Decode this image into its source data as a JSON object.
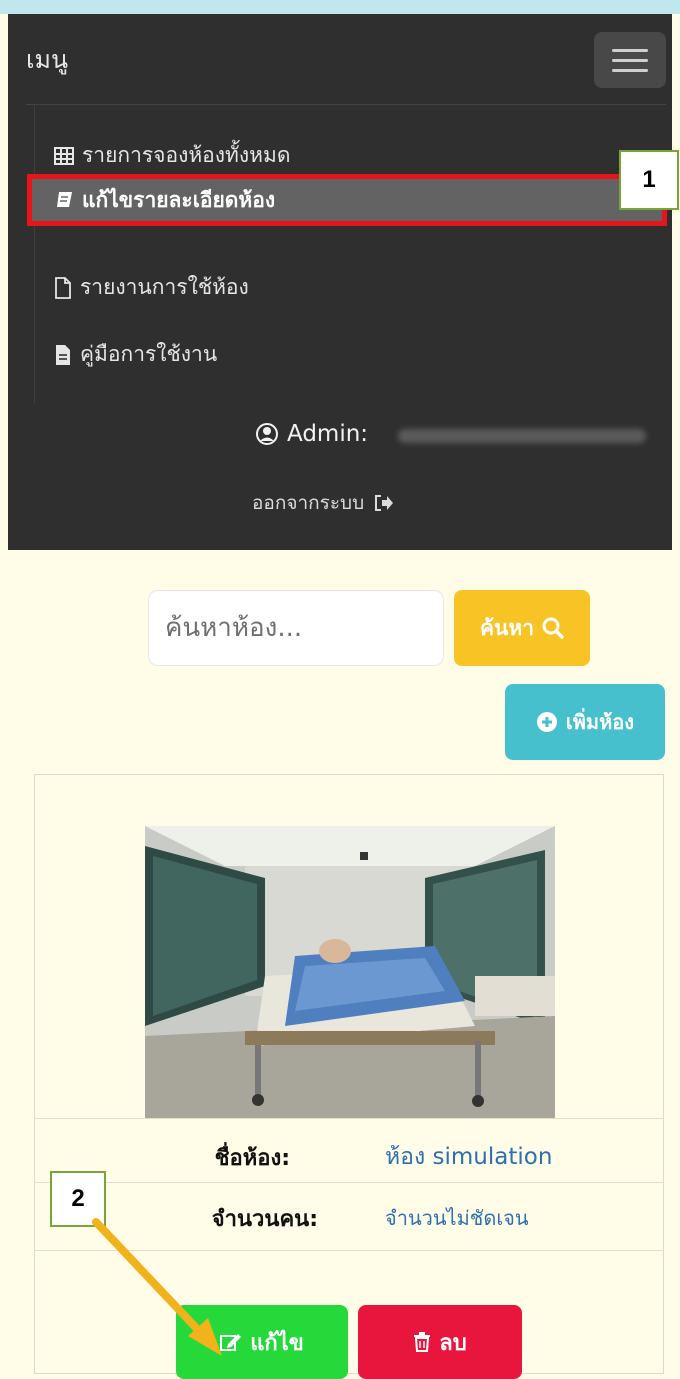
{
  "navbar": {
    "brand": "เมนู",
    "toggle_icon": "hamburger-icon",
    "items": [
      {
        "label": "รายการจองห้องทั้งหมด",
        "icon": "table-icon",
        "active": false
      },
      {
        "label": "แก้ไขรายละเอียดห้อง",
        "icon": "book-icon",
        "active": true
      },
      {
        "label": "รายงานการใช้ห้อง",
        "icon": "file-outline-icon",
        "active": false
      },
      {
        "label": "คู่มือการใช้งาน",
        "icon": "file-text-icon",
        "active": false
      }
    ],
    "user_label": "Admin:",
    "user_icon": "user-circle-icon",
    "logout_label": "ออกจากระบบ",
    "logout_icon": "sign-out-icon"
  },
  "search": {
    "placeholder": "ค้นหาห้อง...",
    "button_label": "ค้นหา",
    "button_icon": "search-icon"
  },
  "add_button_label": "เพิ่มห้อง",
  "room": {
    "name_label": "ชื่อห้อง:",
    "name_value": "ห้อง simulation",
    "capacity_label": "จำนวนคน:",
    "capacity_value": "จำนวนไม่ชัดเจน",
    "edit_label": "แก้ไข",
    "delete_label": "ลบ"
  },
  "callouts": {
    "first": "1",
    "second": "2"
  },
  "colors": {
    "nav_bg": "#2f2f2f",
    "highlight_border": "#e8141b",
    "search_button": "#f8c425",
    "add_button": "#45c0cc",
    "edit_button": "#26d93b",
    "delete_button": "#e8163c",
    "link_value": "#2d6fb0",
    "arrow": "#f2b21c"
  }
}
